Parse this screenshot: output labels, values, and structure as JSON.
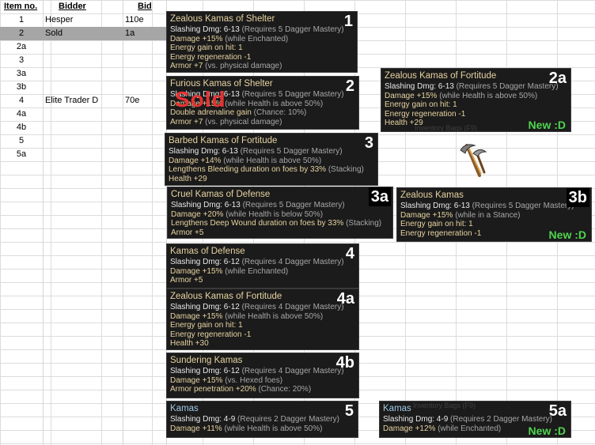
{
  "table": {
    "headers": {
      "item": "Item no.",
      "bidder": "Bidder",
      "bid": "Bid"
    },
    "rows": [
      {
        "item": "1",
        "bidder": "Hesper",
        "bid": "110e",
        "sold": false
      },
      {
        "item": "2",
        "bidder": "Sold",
        "bid": "1a",
        "sold": true
      },
      {
        "item": "2a",
        "bidder": "",
        "bid": "",
        "sold": false
      },
      {
        "item": "3",
        "bidder": "",
        "bid": "",
        "sold": false
      },
      {
        "item": "3a",
        "bidder": "",
        "bid": "",
        "sold": false
      },
      {
        "item": "3b",
        "bidder": "",
        "bid": "",
        "sold": false
      },
      {
        "item": "4",
        "bidder": "Elite Trader D",
        "bid": "70e",
        "sold": false
      },
      {
        "item": "4a",
        "bidder": "",
        "bid": "",
        "sold": false
      },
      {
        "item": "4b",
        "bidder": "",
        "bid": "",
        "sold": false
      },
      {
        "item": "5",
        "bidder": "",
        "bid": "",
        "sold": false
      },
      {
        "item": "5a",
        "bidder": "",
        "bid": "",
        "sold": false
      }
    ]
  },
  "tooltips": [
    {
      "id": "1",
      "title": "Zealous Kamas of Shelter",
      "lines": [
        [
          "Slashing Dmg: 6-13",
          " (Requires 5 Dagger Mastery)"
        ],
        [
          "Damage +15%",
          " (while Enchanted)"
        ],
        [
          "Energy gain on hit: 1",
          ""
        ],
        [
          "Energy regeneration -1",
          ""
        ],
        [
          "Armor +7",
          " (vs. physical damage)"
        ]
      ]
    },
    {
      "id": "2",
      "title": "Furious Kamas of Shelter",
      "overlay": "Sold",
      "lines": [
        [
          "Slashing Dmg: 6-13",
          " (Requires 5 Dagger Mastery)"
        ],
        [
          "Damage +15%",
          " (while Health is above 50%)"
        ],
        [
          "Double adrenaline gain",
          " (Chance: 10%)"
        ],
        [
          "Armor +7",
          " (vs. physical damage)"
        ]
      ]
    },
    {
      "id": "2a",
      "title": "Zealous Kamas of Fortitude",
      "badge": "New :D",
      "lines": [
        [
          "Slashing Dmg: 6-13",
          " (Requires 5 Dagger Mastery)"
        ],
        [
          "Damage +15%",
          " (while Health is above 50%)"
        ],
        [
          "Energy gain on hit: 1",
          ""
        ],
        [
          "Energy regeneration -1",
          ""
        ],
        [
          "Health +29",
          ""
        ]
      ]
    },
    {
      "id": "3",
      "title": "Barbed Kamas of Fortitude",
      "lines": [
        [
          "Slashing Dmg: 6-13",
          " (Requires 5 Dagger Mastery)"
        ],
        [
          "Damage +14%",
          " (while Health is above 50%)"
        ],
        [
          "Lengthens Bleeding duration on foes by 33%",
          " (Stacking)"
        ],
        [
          "Health +29",
          ""
        ]
      ]
    },
    {
      "id": "3a",
      "title": "Cruel Kamas of Defense",
      "lines": [
        [
          "Slashing Dmg: 6-13",
          " (Requires 5 Dagger Mastery)"
        ],
        [
          "Damage +20%",
          " (while Health is below 50%)"
        ],
        [
          "Lengthens Deep Wound duration on foes by 33%",
          " (Stacking)"
        ],
        [
          "Armor +5",
          ""
        ]
      ]
    },
    {
      "id": "3b",
      "title": "Zealous Kamas",
      "badge": "New :D",
      "lines": [
        [
          "Slashing Dmg: 6-13",
          " (Requires 5 Dagger Mastery)"
        ],
        [
          "Damage +15%",
          " (while in a Stance)"
        ],
        [
          "Energy gain on hit: 1",
          ""
        ],
        [
          "Energy regeneration -1",
          ""
        ]
      ]
    },
    {
      "id": "4",
      "title": "Kamas of Defense",
      "lines": [
        [
          "Slashing Dmg: 6-12",
          " (Requires 4 Dagger Mastery)"
        ],
        [
          "Damage +15%",
          " (while Enchanted)"
        ],
        [
          "Armor +5",
          ""
        ]
      ]
    },
    {
      "id": "4a",
      "title": "Zealous Kamas of Fortitude",
      "lines": [
        [
          "Slashing Dmg: 6-12",
          " (Requires 4 Dagger Mastery)"
        ],
        [
          "Damage +15%",
          " (while Health is above 50%)"
        ],
        [
          "Energy gain on hit: 1",
          ""
        ],
        [
          "Energy regeneration -1",
          ""
        ],
        [
          "Health +30",
          ""
        ]
      ]
    },
    {
      "id": "4b",
      "title": "Sundering Kamas",
      "lines": [
        [
          "Slashing Dmg: 6-12",
          " (Requires 4 Dagger Mastery)"
        ],
        [
          "Damage +15%",
          " (vs. Hexed foes)"
        ],
        [
          "Armor penetration +20%",
          " (Chance: 20%)"
        ]
      ]
    },
    {
      "id": "5",
      "title": "Kamas",
      "blue": true,
      "lines": [
        [
          "Slashing Dmg: 4-9",
          " (Requires 2 Dagger Mastery)"
        ],
        [
          "Damage +11%",
          " (while Health is above 50%)"
        ]
      ]
    },
    {
      "id": "5a",
      "title": "Kamas",
      "blue": true,
      "badge": "New :D",
      "lines": [
        [
          "Slashing Dmg: 4-9",
          " (Requires 2 Dagger Mastery)"
        ],
        [
          "Damage +12%",
          " (while Enchanted)"
        ]
      ]
    }
  ],
  "background_text": {
    "inventory": "Inventory Bags (F9)"
  },
  "colors": {
    "tooltip_bg": "#1b1b1b",
    "mod_text": "#e7d3a1",
    "new_badge": "#4fd44f",
    "sold_text": "#e53232",
    "sold_row": "#a6a6a6"
  }
}
